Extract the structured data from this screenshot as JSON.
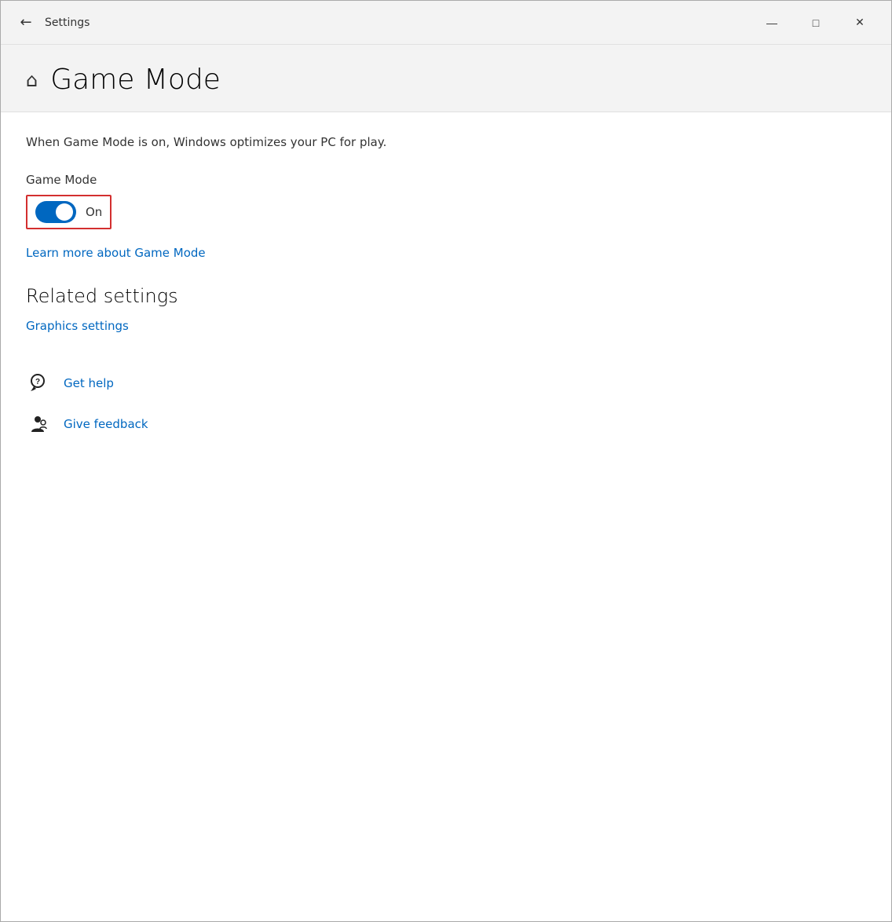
{
  "window": {
    "title": "Settings",
    "controls": {
      "minimize": "—",
      "maximize": "□",
      "close": "✕"
    }
  },
  "header": {
    "title": "Game Mode",
    "home_icon": "⌂"
  },
  "content": {
    "description": "When Game Mode is on, Windows optimizes your PC for play.",
    "game_mode_label": "Game Mode",
    "toggle_state": "On",
    "learn_more_link": "Learn more about Game Mode",
    "related_settings": {
      "title": "Related settings",
      "graphics_link": "Graphics settings"
    },
    "help": {
      "get_help_label": "Get help",
      "feedback_label": "Give feedback"
    }
  }
}
